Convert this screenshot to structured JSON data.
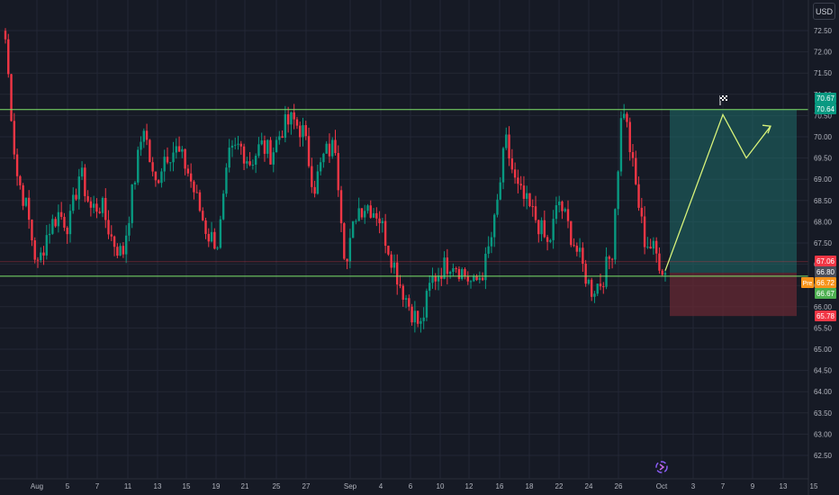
{
  "toolbar": {
    "currency_label": "USD"
  },
  "colors": {
    "background": "#161a25",
    "grid": "#232735",
    "up_candle": "#089981",
    "down_candle": "#f23645",
    "range_line": "#7ee36a",
    "axis_text": "#b2b5be",
    "profit_zone": "#1f6e6a",
    "loss_zone": "#6b2a33",
    "projection_line": "#d8f37a"
  },
  "icons": {
    "target_flag": "checkered-flag-icon",
    "watermark": "logo-swirl-icon"
  },
  "chart_data": {
    "type": "candlestick",
    "x_tick_labels": [
      "Aug",
      "5",
      "7",
      "11",
      "13",
      "15",
      "19",
      "21",
      "25",
      "27",
      "Sep",
      "4",
      "6",
      "10",
      "12",
      "16",
      "18",
      "22",
      "24",
      "26",
      "Oct",
      "3",
      "7",
      "9",
      "13",
      "15"
    ],
    "y_tick_labels": [
      "72.50",
      "72.00",
      "71.50",
      "71.00",
      "70.50",
      "70.00",
      "69.50",
      "69.00",
      "68.50",
      "68.00",
      "67.50",
      "67.00",
      "66.50",
      "66.00",
      "65.50",
      "65.00",
      "64.50",
      "64.00",
      "63.50",
      "63.00",
      "62.50"
    ],
    "ylim": [
      62.25,
      72.85
    ],
    "price_tags": [
      {
        "label": "70.67",
        "value": 70.67,
        "color": "#089981"
      },
      {
        "label": "70.64",
        "value": 70.64,
        "color": "#089981"
      },
      {
        "label": "67.06",
        "value": 67.06,
        "color": "#f23645"
      },
      {
        "label": "66.80",
        "value": 66.8,
        "color": "#4a4e5a"
      },
      {
        "label": "66.72",
        "value": 66.72,
        "color": "#f7931a",
        "prefix": "Pre"
      },
      {
        "label": "66.67",
        "value": 66.67,
        "color": "#4caf50"
      },
      {
        "label": "65.78",
        "value": 65.78,
        "color": "#f23645"
      }
    ],
    "range_lines": [
      70.64,
      66.72
    ],
    "position": {
      "entry": 66.8,
      "target": 70.64,
      "stop": 65.78
    },
    "projection_path": [
      {
        "date": "Oct 1",
        "price": 66.85
      },
      {
        "date": "Oct 7",
        "price": 70.52
      },
      {
        "date": "Oct 9",
        "price": 69.5
      },
      {
        "date": "Oct 12",
        "price": 70.25
      }
    ],
    "close_path": [
      {
        "date": "Jul 31",
        "price": 72.3
      },
      {
        "date": "Aug 1",
        "price": 69.2
      },
      {
        "date": "Aug 2",
        "price": 68.3
      },
      {
        "date": "Aug 2b",
        "price": 66.9
      },
      {
        "date": "Aug 3",
        "price": 67.8
      },
      {
        "date": "Aug 4",
        "price": 68.2
      },
      {
        "date": "Aug 5",
        "price": 67.9
      },
      {
        "date": "Aug 6",
        "price": 69.2
      },
      {
        "date": "Aug 7",
        "price": 68.3
      },
      {
        "date": "Aug 8",
        "price": 68.4
      },
      {
        "date": "Aug 9",
        "price": 67.6
      },
      {
        "date": "Aug 11",
        "price": 67.2
      },
      {
        "date": "Aug 12",
        "price": 68.8
      },
      {
        "date": "Aug 13",
        "price": 70.3
      },
      {
        "date": "Aug 14",
        "price": 68.8
      },
      {
        "date": "Aug 15",
        "price": 69.6
      },
      {
        "date": "Aug 17",
        "price": 69.7
      },
      {
        "date": "Aug 18",
        "price": 69.3
      },
      {
        "date": "Aug 19",
        "price": 68.5
      },
      {
        "date": "Aug 20",
        "price": 67.7
      },
      {
        "date": "Aug 21",
        "price": 67.5
      },
      {
        "date": "Aug 22",
        "price": 69.5
      },
      {
        "date": "Aug 23",
        "price": 69.8
      },
      {
        "date": "Aug 25",
        "price": 69.4
      },
      {
        "date": "Aug 26",
        "price": 69.8
      },
      {
        "date": "Aug 27",
        "price": 69.6
      },
      {
        "date": "Aug 28",
        "price": 70.2
      },
      {
        "date": "Aug 29",
        "price": 70.4
      },
      {
        "date": "Aug 30",
        "price": 70.1
      },
      {
        "date": "Sep 1",
        "price": 68.8
      },
      {
        "date": "Sep 2",
        "price": 69.6
      },
      {
        "date": "Sep 3",
        "price": 69.8
      },
      {
        "date": "Sep 3b",
        "price": 66.9
      },
      {
        "date": "Sep 4",
        "price": 68.3
      },
      {
        "date": "Sep 5",
        "price": 68.4
      },
      {
        "date": "Sep 6",
        "price": 68.2
      },
      {
        "date": "Sep 7",
        "price": 67.4
      },
      {
        "date": "Sep 8",
        "price": 66.6
      },
      {
        "date": "Sep 9",
        "price": 66.0
      },
      {
        "date": "Sep 10",
        "price": 65.5
      },
      {
        "date": "Sep 11",
        "price": 66.6
      },
      {
        "date": "Sep 12",
        "price": 66.9
      },
      {
        "date": "Sep 13",
        "price": 67.1
      },
      {
        "date": "Sep 14",
        "price": 66.8
      },
      {
        "date": "Sep 15",
        "price": 66.5
      },
      {
        "date": "Sep 16",
        "price": 66.9
      },
      {
        "date": "Sep 17",
        "price": 68.0
      },
      {
        "date": "Sep 18",
        "price": 69.9
      },
      {
        "date": "Sep 19",
        "price": 68.8
      },
      {
        "date": "Sep 20",
        "price": 68.4
      },
      {
        "date": "Sep 21",
        "price": 68.0
      },
      {
        "date": "Sep 22",
        "price": 67.4
      },
      {
        "date": "Sep 23",
        "price": 68.5
      },
      {
        "date": "Sep 24",
        "price": 67.8
      },
      {
        "date": "Sep 25",
        "price": 67.1
      },
      {
        "date": "Sep 26",
        "price": 66.4
      },
      {
        "date": "Sep 27",
        "price": 66.6
      },
      {
        "date": "Sep 28",
        "price": 67.3
      },
      {
        "date": "Sep 29",
        "price": 70.9
      },
      {
        "date": "Sep 29b",
        "price": 69.2
      },
      {
        "date": "Sep 30",
        "price": 67.6
      },
      {
        "date": "Sep 30b",
        "price": 67.3
      },
      {
        "date": "Oct 1",
        "price": 66.8
      }
    ]
  }
}
